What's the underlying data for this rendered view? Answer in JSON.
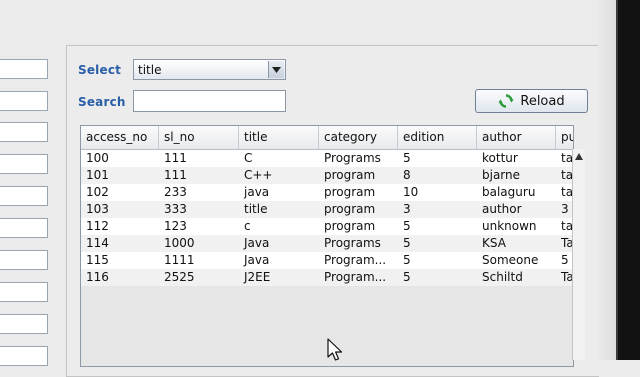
{
  "filter": {
    "select_label": "Select",
    "select_value": "title",
    "search_label": "Search",
    "search_value": ""
  },
  "toolbar": {
    "reload_label": "Reload"
  },
  "table": {
    "columns": [
      "access_no",
      "sl_no",
      "title",
      "category",
      "edition",
      "author",
      "pu"
    ],
    "rows": [
      [
        "100",
        "111",
        "C",
        "Programs",
        "5",
        "kottur",
        "ta"
      ],
      [
        "101",
        "111",
        "C++",
        "program",
        "8",
        "bjarne",
        "ta"
      ],
      [
        "102",
        "233",
        "java",
        "program",
        "10",
        "balaguru",
        "ta"
      ],
      [
        "103",
        "333",
        "title",
        "program",
        "3",
        "author",
        "3"
      ],
      [
        "112",
        "123",
        "c",
        "program",
        "5",
        "unknown",
        "ta"
      ],
      [
        "114",
        "1000",
        "Java",
        "Programs",
        "5",
        "KSA",
        "Ta"
      ],
      [
        "115",
        "1111",
        "Java",
        "Program...",
        "5",
        "Someone",
        "5"
      ],
      [
        "116",
        "2525",
        "J2EE",
        "Program...",
        "5",
        "Schiltd",
        "Ta"
      ]
    ]
  },
  "colors": {
    "label_blue": "#2a5fa8"
  },
  "icons": {
    "reload": "refresh-icon",
    "dropdown": "chevron-down-icon",
    "scroll_up": "arrow-up-icon"
  }
}
